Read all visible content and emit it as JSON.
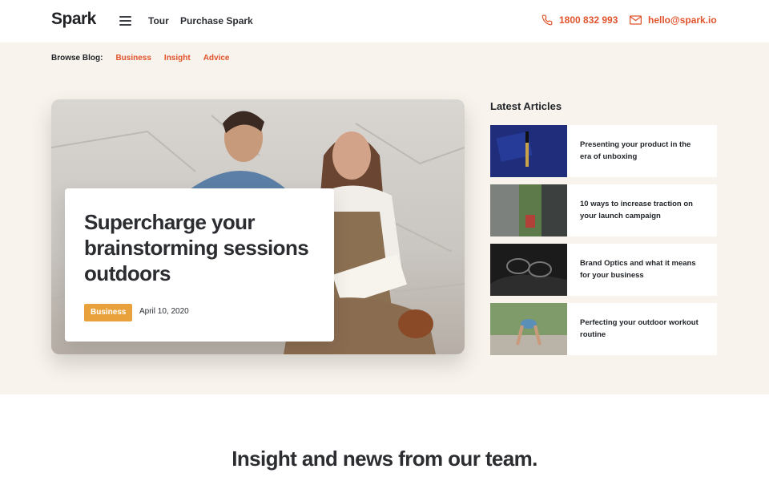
{
  "header": {
    "logo": "Spark",
    "menu_icon": "hamburger-menu-icon",
    "nav": [
      "Tour",
      "Purchase Spark"
    ],
    "phone": "1800 832 993",
    "phone_icon": "phone-icon",
    "email": "hello@spark.io",
    "email_icon": "mail-icon",
    "accent_color": "#e0532c"
  },
  "browse": {
    "label": "Browse Blog:",
    "links": [
      "Business",
      "Insight",
      "Advice"
    ]
  },
  "feature": {
    "title": "Supercharge your brainstorming sessions outdoors",
    "badge": "Business",
    "badge_color": "#e9a23b",
    "date": "April 10, 2020"
  },
  "latest": {
    "heading": "Latest Articles",
    "articles": [
      {
        "title": "Presenting your product in the era of unboxing"
      },
      {
        "title": "10 ways to increase traction on your launch campaign"
      },
      {
        "title": "Brand Optics and what it means for your business"
      },
      {
        "title": "Perfecting your outdoor workout routine"
      }
    ]
  },
  "section": {
    "heading": "Insight and news from our team."
  },
  "colors": {
    "hero_background": "#f8f3ec"
  }
}
